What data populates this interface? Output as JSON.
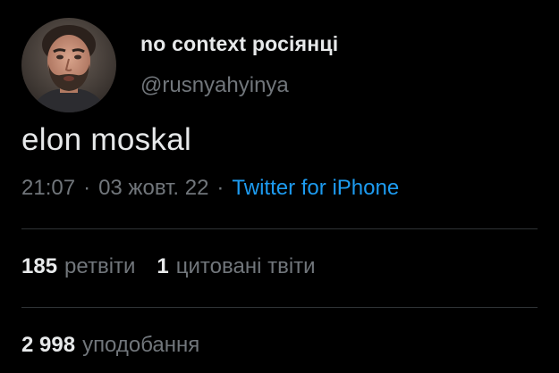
{
  "author": {
    "display_name": "no context росіянці",
    "handle": "@rusnyahyinya",
    "avatar": "profile-photo-bearded-man"
  },
  "tweet": {
    "text": "elon moskal",
    "time": "21:07",
    "separator": "·",
    "date": "03 жовт. 22",
    "source": "Twitter for iPhone"
  },
  "stats": {
    "retweets": {
      "count": "185",
      "label": "ретвіти"
    },
    "quote_tweets": {
      "count": "1",
      "label": "цитовані твіти"
    },
    "likes": {
      "count": "2 998",
      "label": "уподобання"
    }
  },
  "colors": {
    "background": "#000000",
    "primary_text": "#e7e9ea",
    "secondary_text": "#71767b",
    "link": "#1d9bf0",
    "divider": "#2f3336"
  }
}
